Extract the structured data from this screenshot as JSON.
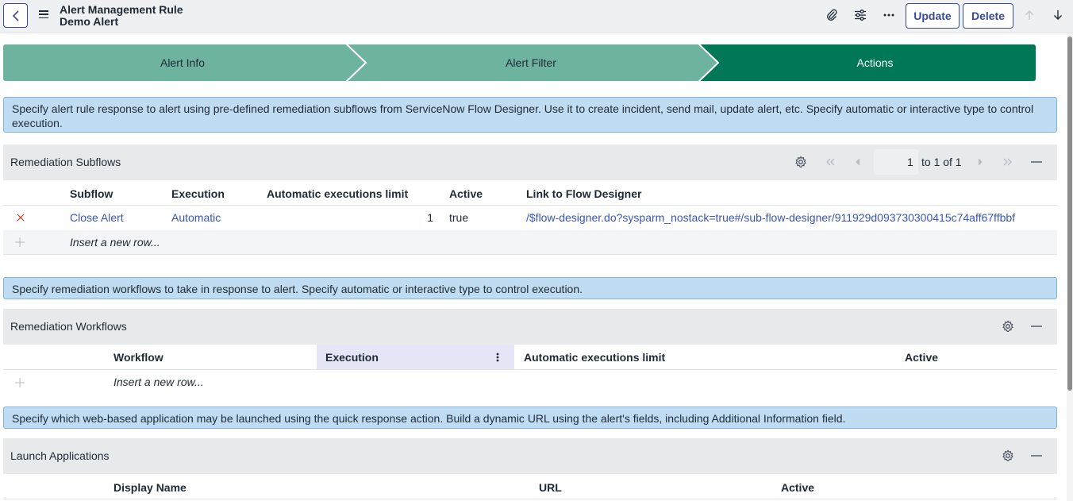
{
  "header": {
    "title_line1": "Alert Management Rule",
    "title_line2": "Demo Alert",
    "update_label": "Update",
    "delete_label": "Delete"
  },
  "stepper": {
    "steps": [
      {
        "label": "Alert Info",
        "state": "complete"
      },
      {
        "label": "Alert Filter",
        "state": "complete"
      },
      {
        "label": "Actions",
        "state": "current"
      }
    ],
    "colors": {
      "complete": "#6db3a0",
      "current": "#007858"
    }
  },
  "subflows_info": "Specify alert rule response to alert using pre-defined remediation subflows from ServiceNow Flow Designer. Use it to create incident, send mail, update alert, etc. Specify automatic or interactive type to control execution.",
  "remediation_subflows": {
    "title": "Remediation Subflows",
    "pager": {
      "current": "1",
      "range_text": "to 1 of 1"
    },
    "columns": [
      "Subflow",
      "Execution",
      "Automatic executions limit",
      "Active",
      "Link to Flow Designer"
    ],
    "rows": [
      {
        "subflow": "Close Alert",
        "execution": "Automatic",
        "limit": "1",
        "active": "true",
        "link": "/$flow-designer.do?sysparm_nostack=true#/sub-flow-designer/911929d093730300415c74aff67ffbbf"
      }
    ],
    "insert_label": "Insert a new row..."
  },
  "workflows_info": "Specify remediation workflows to take in response to alert. Specify automatic or interactive type to control execution.",
  "remediation_workflows": {
    "title": "Remediation Workflows",
    "columns": [
      "Workflow",
      "Execution",
      "Automatic executions limit",
      "Active"
    ],
    "insert_label": "Insert a new row..."
  },
  "launch_info": "Specify which web-based application may be launched using the quick response action. Build a dynamic URL using the alert's fields, including Additional Information field.",
  "launch_applications": {
    "title": "Launch Applications",
    "columns": [
      "Display Name",
      "URL",
      "Active"
    ]
  },
  "icons": [
    "chevron-left-icon",
    "hamburger-menu-icon",
    "paperclip-icon",
    "sliders-icon",
    "more-icon",
    "arrow-up-icon",
    "arrow-down-icon",
    "gear-icon",
    "collapse-icon",
    "delete-x-icon",
    "plus-icon",
    "column-menu-icon"
  ]
}
